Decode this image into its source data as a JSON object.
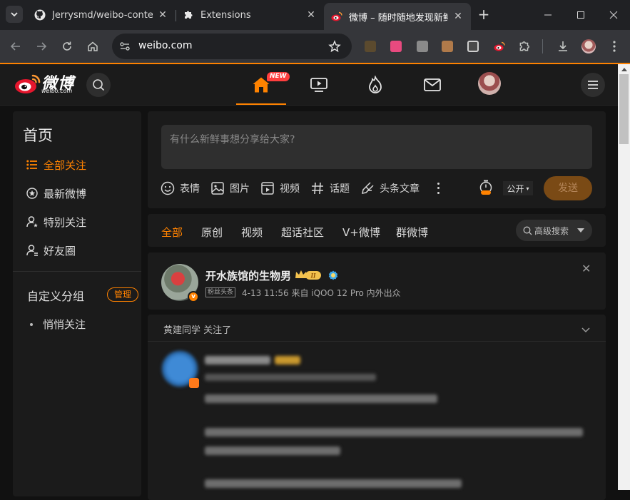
{
  "browser": {
    "tabs": [
      {
        "title": "Jerrysmd/weibo-content-",
        "active": false
      },
      {
        "title": "Extensions",
        "active": false
      },
      {
        "title": "微博 – 随时随地发现新鲜",
        "active": true
      }
    ],
    "url": "weibo.com"
  },
  "header": {
    "logo_text": "微博",
    "logo_sub": "weibo.com",
    "new_badge": "NEW",
    "nav_icons": [
      "home-icon",
      "video-icon",
      "hot-icon",
      "message-icon",
      "avatar"
    ]
  },
  "sidebar": {
    "title": "首页",
    "items": [
      {
        "label": "全部关注",
        "icon": "list-icon",
        "active": true
      },
      {
        "label": "最新微博",
        "icon": "star-icon",
        "active": false
      },
      {
        "label": "特别关注",
        "icon": "user-star-icon",
        "active": false
      },
      {
        "label": "好友圈",
        "icon": "user-group-icon",
        "active": false
      }
    ],
    "group_title": "自定义分组",
    "manage_label": "管理",
    "sub_items": [
      "悄悄关注"
    ]
  },
  "composer": {
    "placeholder": "有什么新鲜事想分享给大家?",
    "tools": [
      {
        "label": "表情",
        "icon": "emoji-icon"
      },
      {
        "label": "图片",
        "icon": "image-icon"
      },
      {
        "label": "视频",
        "icon": "video-icon"
      },
      {
        "label": "话题",
        "icon": "hashtag-icon"
      },
      {
        "label": "头条文章",
        "icon": "article-icon"
      }
    ],
    "visibility": "公开",
    "send_label": "发送"
  },
  "filters": {
    "tabs": [
      "全部",
      "原创",
      "视频",
      "超话社区",
      "V+微博",
      "群微博"
    ],
    "active": "全部",
    "search_label": "高级搜索"
  },
  "posts": [
    {
      "author": "开水族馆的生物男",
      "badge_text": "粉丝头条",
      "meta": "4-13 11:56  来自 iQOO 12 Pro 内外出众"
    },
    {
      "follow_note": "黄建同学 关注了"
    }
  ],
  "colors": {
    "accent": "#ff8200",
    "background": "#111111",
    "card": "#1b1b1b"
  }
}
